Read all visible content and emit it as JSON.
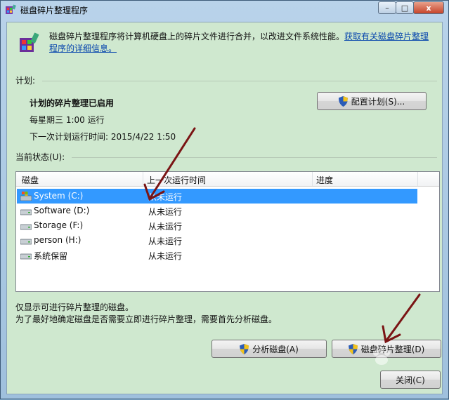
{
  "window": {
    "title": "磁盘碎片整理程序",
    "caption_minimize": "–",
    "caption_maximize": "□",
    "caption_close": "x"
  },
  "header": {
    "description": "磁盘碎片整理程序将计算机硬盘上的碎片文件进行合并，以改进文件系统性能。",
    "link_text": "获取有关磁盘碎片整理程序的详细信息。"
  },
  "schedule": {
    "section_label": "计划:",
    "status": "计划的碎片整理已启用",
    "frequency": "每星期三  1:00 运行",
    "next_run": "下一次计划运行时间: 2015/4/22 1:50",
    "configure_button": "配置计划(S)..."
  },
  "current_status": {
    "section_label": "当前状态(U):",
    "columns": [
      "磁盘",
      "上一次运行时间",
      "进度"
    ],
    "rows": [
      {
        "disk": "System (C:)",
        "last_run": "从未运行",
        "progress": "",
        "icon": "system-drive-icon",
        "selected": true
      },
      {
        "disk": "Software (D:)",
        "last_run": "从未运行",
        "progress": "",
        "icon": "drive-icon",
        "selected": false
      },
      {
        "disk": "Storage (F:)",
        "last_run": "从未运行",
        "progress": "",
        "icon": "drive-icon",
        "selected": false
      },
      {
        "disk": "person (H:)",
        "last_run": "从未运行",
        "progress": "",
        "icon": "drive-icon",
        "selected": false
      },
      {
        "disk": "系统保留",
        "last_run": "从未运行",
        "progress": "",
        "icon": "drive-icon",
        "selected": false
      }
    ]
  },
  "footer": {
    "note1": "仅显示可进行碎片整理的磁盘。",
    "note2": "为了最好地确定磁盘是否需要立即进行碎片整理，需要首先分析磁盘。",
    "analyze_button": "分析磁盘(A)",
    "defrag_button": "磁盘碎片整理(D)",
    "close_button": "关闭(C)"
  },
  "colors": {
    "client_bg": "#cfe8cf",
    "selection": "#3399ff",
    "link": "#0645ad",
    "annotation_arrow": "#7a1414"
  }
}
